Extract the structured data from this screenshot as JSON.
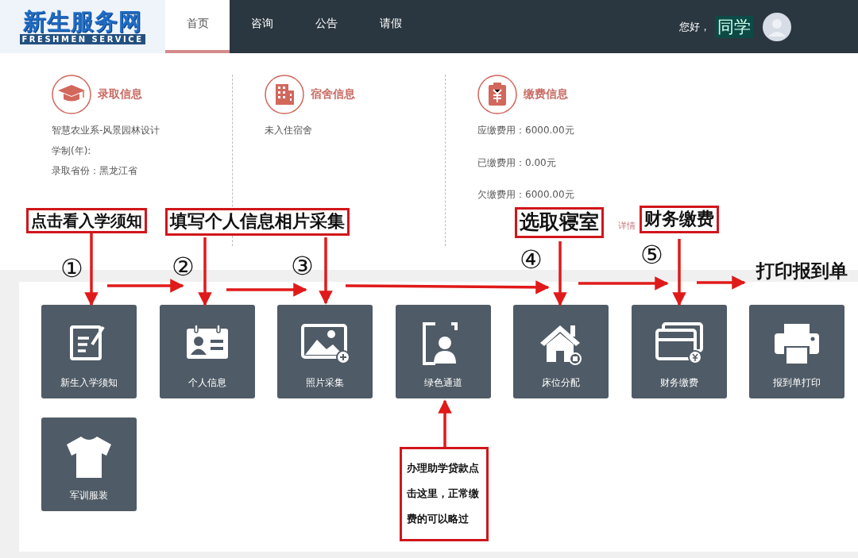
{
  "header": {
    "logo": {
      "title": "新生服务网",
      "subtitle": "FRESHMEN SERVICE"
    },
    "nav": [
      {
        "label": "首页",
        "selected": true
      },
      {
        "label": "咨询",
        "selected": false
      },
      {
        "label": "公告",
        "selected": false
      },
      {
        "label": "请假",
        "selected": false
      }
    ],
    "greeting": "您好，",
    "user": "同学"
  },
  "info_sections": [
    {
      "title": "录取信息",
      "lines": [
        "智慧农业系-风景园林设计",
        "学制(年):",
        "录取省份：黑龙江省"
      ]
    },
    {
      "title": "宿舍信息",
      "lines": [
        "未入住宿舍"
      ]
    },
    {
      "title": "缴费信息",
      "lines": [
        "应缴费用：6000.00元",
        "已缴费用：0.00元",
        "欠缴费用：6000.00元"
      ]
    }
  ],
  "details_link": "详情",
  "tiles": [
    "新生入学须知",
    "个人信息",
    "照片采集",
    "绿色通道",
    "床位分配",
    "财务缴费",
    "报到单打印",
    "军训服装"
  ],
  "annotations": {
    "callouts": [
      "点击看入学须知",
      "填写个人信息相片采集",
      "选取寝室",
      "财务缴费",
      "办理助学贷款点击这里，正常缴费的可以略过"
    ],
    "steps": [
      "①",
      "②",
      "③",
      "④",
      "⑤"
    ],
    "final_step": "打印报到单"
  }
}
